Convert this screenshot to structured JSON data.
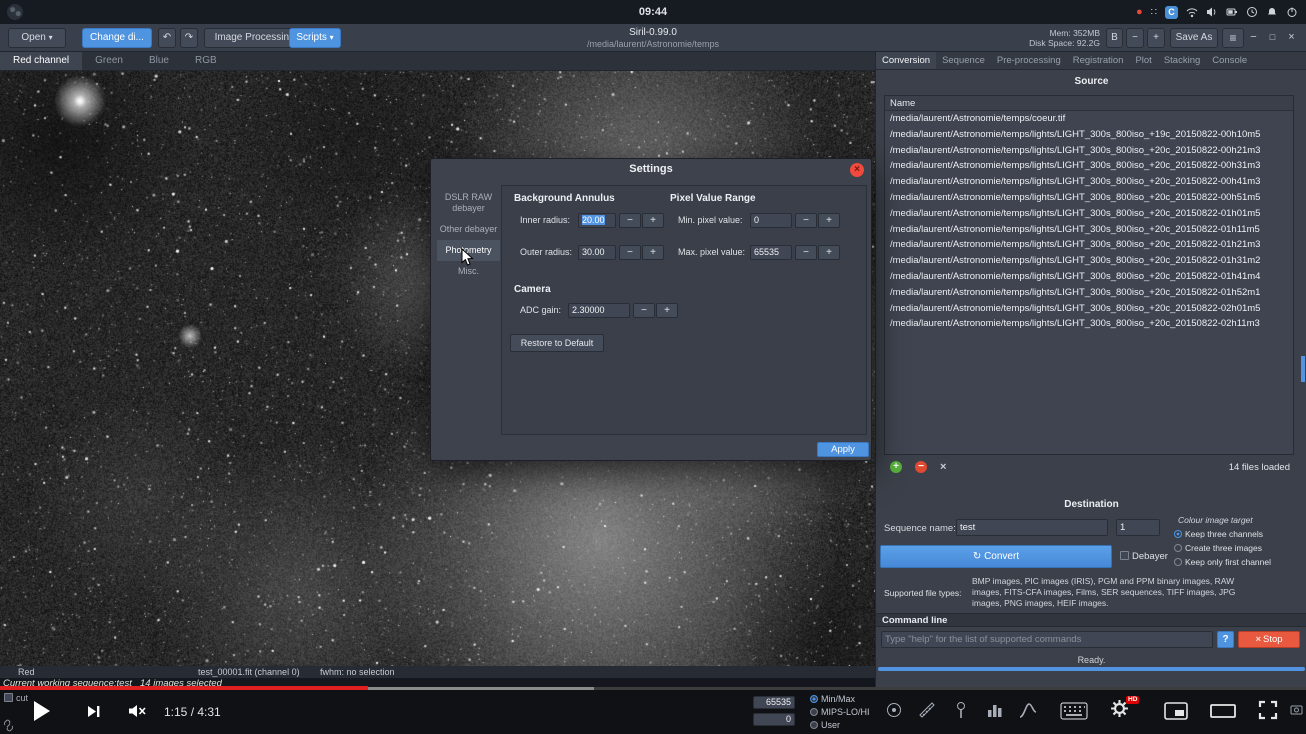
{
  "system_bar": {
    "time": "09:44"
  },
  "toolbar": {
    "open": "Open",
    "change_dir": "Change di...",
    "image_processing": "Image Processing",
    "scripts": "Scripts",
    "title": "Siril-0.99.0",
    "path": "/media/laurent/Astronomie/temps",
    "mem": "Mem: 352MB",
    "disk": "Disk Space: 92.2G",
    "b": "B",
    "save_as": "Save As"
  },
  "channel_tabs": {
    "red": "Red channel",
    "green": "Green",
    "blue": "Blue",
    "rgb": "RGB"
  },
  "image_status": {
    "channel": "Red",
    "file": "test_00001.fit (channel 0)",
    "fwhm": "fwhm: no selection"
  },
  "sequence_bar": {
    "working": "Current working sequence:test",
    "selected": "14 images selected"
  },
  "settings_dialog": {
    "title": "Settings",
    "tabs": [
      "DSLR RAW debayer",
      "Other debayer",
      "Photometry",
      "Misc."
    ],
    "annulus_header": "Background Annulus",
    "inner_label": "Inner radius:",
    "inner_value": "20.00",
    "outer_label": "Outer radius:",
    "outer_value": "30.00",
    "pixel_header": "Pixel Value Range",
    "min_label": "Min. pixel value:",
    "min_value": "0",
    "max_label": "Max. pixel value:",
    "max_value": "65535",
    "camera_header": "Camera",
    "adc_label": "ADC gain:",
    "adc_value": "2.30000",
    "restore": "Restore to Default",
    "apply": "Apply"
  },
  "right_panel": {
    "tabs": [
      "Conversion",
      "Sequence",
      "Pre-processing",
      "Registration",
      "Plot",
      "Stacking",
      "Console"
    ],
    "source_header": "Source",
    "name_column": "Name",
    "files": [
      "/media/laurent/Astronomie/temps/coeur.tif",
      "/media/laurent/Astronomie/temps/lights/LIGHT_300s_800iso_+19c_20150822-00h10m5",
      "/media/laurent/Astronomie/temps/lights/LIGHT_300s_800iso_+20c_20150822-00h21m3",
      "/media/laurent/Astronomie/temps/lights/LIGHT_300s_800iso_+20c_20150822-00h31m3",
      "/media/laurent/Astronomie/temps/lights/LIGHT_300s_800iso_+20c_20150822-00h41m3",
      "/media/laurent/Astronomie/temps/lights/LIGHT_300s_800iso_+20c_20150822-00h51m5",
      "/media/laurent/Astronomie/temps/lights/LIGHT_300s_800iso_+20c_20150822-01h01m5",
      "/media/laurent/Astronomie/temps/lights/LIGHT_300s_800iso_+20c_20150822-01h11m5",
      "/media/laurent/Astronomie/temps/lights/LIGHT_300s_800iso_+20c_20150822-01h21m3",
      "/media/laurent/Astronomie/temps/lights/LIGHT_300s_800iso_+20c_20150822-01h31m2",
      "/media/laurent/Astronomie/temps/lights/LIGHT_300s_800iso_+20c_20150822-01h41m4",
      "/media/laurent/Astronomie/temps/lights/LIGHT_300s_800iso_+20c_20150822-01h52m1",
      "/media/laurent/Astronomie/temps/lights/LIGHT_300s_800iso_+20c_20150822-02h01m5",
      "/media/laurent/Astronomie/temps/lights/LIGHT_300s_800iso_+20c_20150822-02h11m3"
    ],
    "files_loaded": "14 files loaded",
    "destination_header": "Destination",
    "sequence_name_label": "Sequence name:",
    "sequence_name_value": "test",
    "index_value": "1",
    "colour_target_label": "Colour image target",
    "radio_options": [
      "Keep three channels",
      "Create three images",
      "Keep only first channel"
    ],
    "convert": "Convert",
    "debayer": "Debayer",
    "supported_label": "Supported file types:",
    "supported_text": "BMP images, PIC images (IRIS), PGM and PPM binary images, RAW images, FITS-CFA images, Films, SER sequences, TIFF images, JPG images, PNG images, HEIF images.",
    "command_header": "Command line",
    "command_placeholder": "Type \"help\" for the list of supported commands",
    "help": "?",
    "stop": "Stop",
    "ready": "Ready."
  },
  "siril_bottom": {
    "cut": "cut",
    "hi": "65535",
    "lo": "0",
    "display_modes": [
      "Min/Max",
      "MIPS-LO/HI",
      "User"
    ]
  },
  "video_player": {
    "time": "1:15 / 4:31",
    "hd": "HD"
  }
}
